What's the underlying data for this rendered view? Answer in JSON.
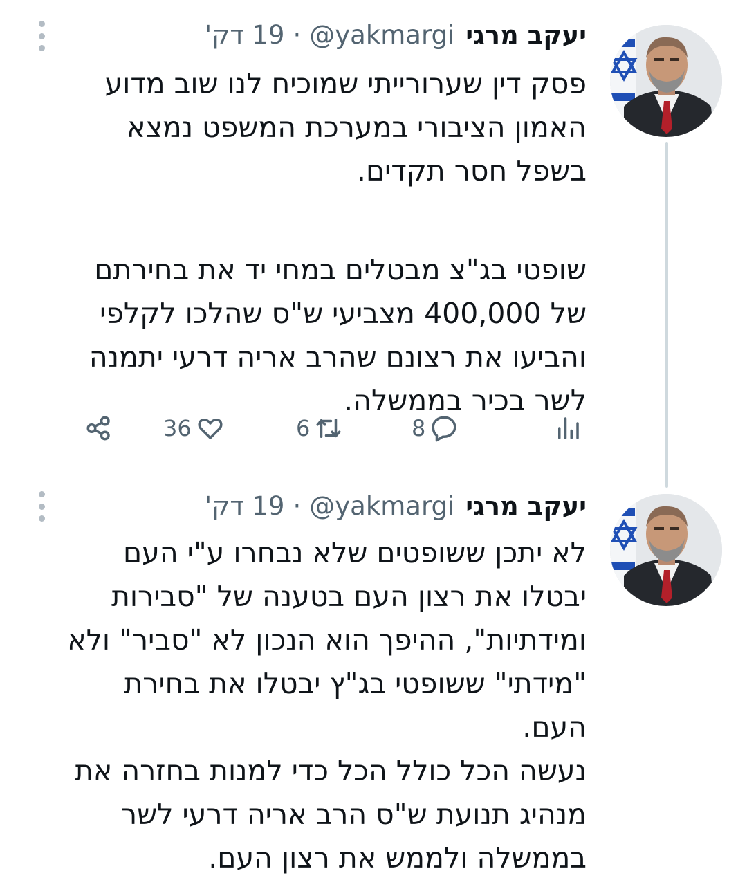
{
  "tweets": [
    {
      "author": {
        "name": "יעקב מרגי",
        "handle": "@yakmargi"
      },
      "time": "19 דק'",
      "dot": "·",
      "paragraphs": [
        "פסק דין שערורייתי שמוכיח לנו שוב מדוע\nהאמון הציבורי במערכת המשפט נמצא\nבשפל חסר תקדים.",
        "שופטי בג\"צ מבטלים במחי יד את בחירתם\nשל 400,000 מצביעי ש\"ס שהלכו לקלפי\nוהביעו את רצונם שהרב אריה דרעי יתמנה\nלשר בכיר בממשלה."
      ],
      "actions": {
        "replies": "8",
        "retweets": "6",
        "likes": "36"
      },
      "icons": {
        "reply": "reply-icon",
        "retweet": "retweet-icon",
        "like": "heart-icon",
        "share": "share-icon",
        "views": "views-icon"
      }
    },
    {
      "author": {
        "name": "יעקב מרגי",
        "handle": "@yakmargi"
      },
      "time": "19 דק'",
      "dot": "·",
      "paragraphs": [
        "לא יתכן ששופטים שלא נבחרו ע\"י העם\nיבטלו את רצון העם בטענה של \"סבירות\nומידתיות\", ההיפך הוא הנכון לא \"סביר\" ולא\n\"מידתי\" ששופטי בג\"ץ יבטלו את בחירת\nהעם.\nנעשה הכל כולל הכל כדי למנות בחזרה את\nמנהיג תנועת ש\"ס הרב אריה דרעי לשר\nבממשלה ולממש את רצון העם."
      ]
    }
  ],
  "colors": {
    "text": "#0f1419",
    "muted": "#536471",
    "thread": "#cfd9de",
    "flagBlue": "#1f4fb5"
  }
}
